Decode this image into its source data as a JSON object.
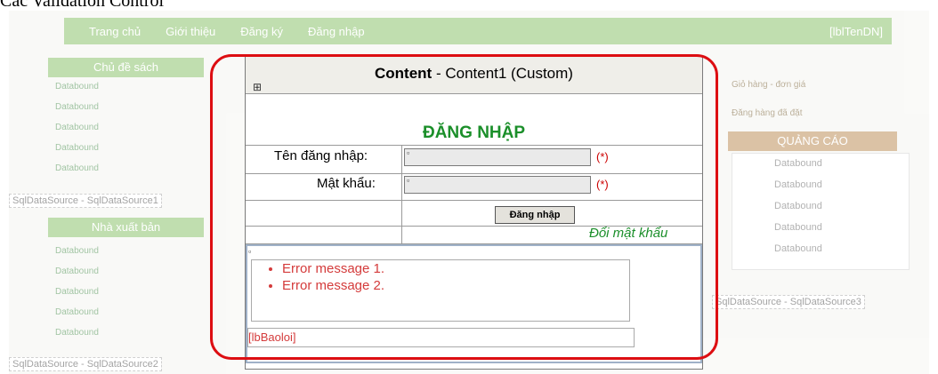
{
  "caption": "Các Validation Control",
  "background": {
    "nav_items": [
      "Trang chủ",
      "Giới thiệu",
      "Đăng ký",
      "Đăng nhập"
    ],
    "nav_right": "[lblTenDN]",
    "topic_box_title": "Chủ đề sách",
    "publisher_box_title": "Nhà xuất bản",
    "databound": "Databound",
    "sql_left_1": "SqlDataSource - SqlDataSource1",
    "sql_left_2": "SqlDataSource - SqlDataSource2",
    "sql_right": "SqlDataSource - SqlDataSource3",
    "notes": [
      "Giỏ hàng - đơn giá",
      "Đăng hàng đã đặt"
    ],
    "ad_title": "QUẢNG CÁO"
  },
  "designer": {
    "content_bold": "Content",
    "content_rest": " - Content1 (Custom)",
    "move_glyph": "⊞",
    "login_title": "ĐĂNG NHẬP",
    "username_label": "Tên đăng nhập:",
    "password_label": "Mật khẩu:",
    "required_marker": "(*)",
    "login_button": "Đăng nhập",
    "change_password_link": "Đổi mật khẩu",
    "errors": [
      "Error message 1.",
      "Error message 2."
    ],
    "error_label": "[lbBaoloi]"
  },
  "colors": {
    "highlight": "#dd0e12",
    "title_green": "#1b8f2a",
    "error_red": "#d43b3b"
  }
}
